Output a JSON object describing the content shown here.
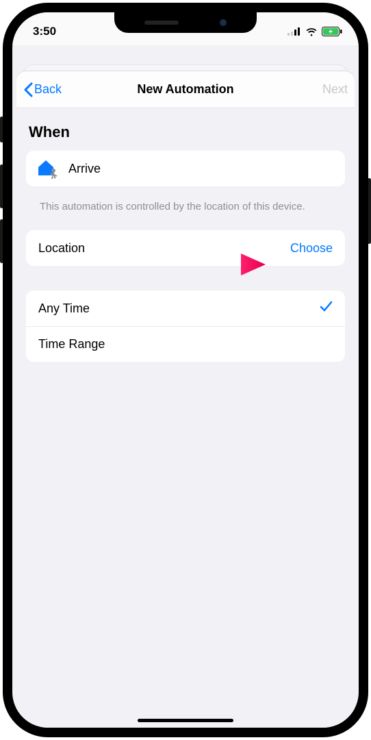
{
  "status": {
    "time": "3:50"
  },
  "nav": {
    "back": "Back",
    "title": "New Automation",
    "next": "Next"
  },
  "section": {
    "heading": "When"
  },
  "trigger": {
    "label": "Arrive",
    "helper": "This automation is controlled by the location of this device."
  },
  "location": {
    "label": "Location",
    "action": "Choose"
  },
  "time": {
    "any": "Any Time",
    "range": "Time Range"
  }
}
